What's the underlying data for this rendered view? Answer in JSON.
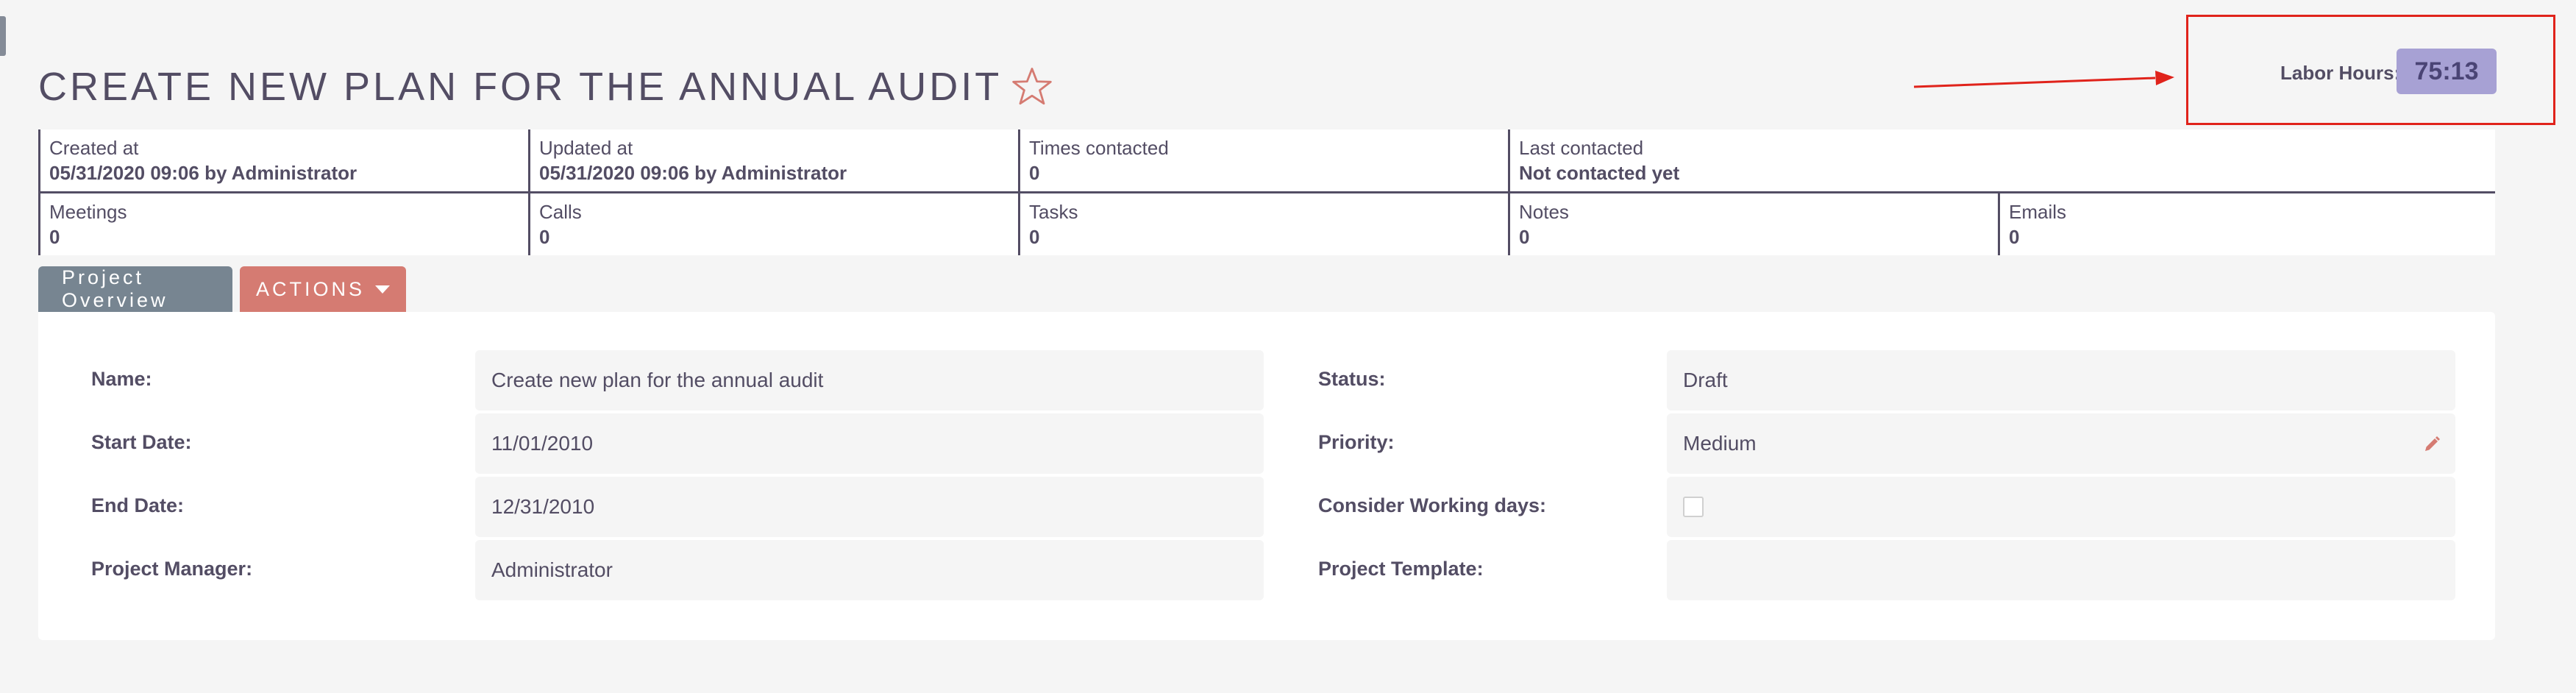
{
  "record": {
    "title": "CREATE NEW PLAN FOR THE ANNUAL AUDIT",
    "favorite_icon": "star-outline-icon"
  },
  "labor": {
    "label": "Labor Hours:",
    "value": "75:13"
  },
  "summary": {
    "row1": [
      {
        "label": "Created at",
        "value": "05/31/2020 09:06 by Administrator"
      },
      {
        "label": "Updated at",
        "value": "05/31/2020 09:06 by Administrator"
      },
      {
        "label": "Times contacted",
        "value": "0"
      },
      {
        "label": "Last contacted",
        "value": "Not contacted yet"
      }
    ],
    "row2": [
      {
        "label": "Meetings",
        "value": "0"
      },
      {
        "label": "Calls",
        "value": "0"
      },
      {
        "label": "Tasks",
        "value": "0"
      },
      {
        "label": "Notes",
        "value": "0"
      },
      {
        "label": "Emails",
        "value": "0"
      }
    ]
  },
  "tabs": {
    "overview": "Project Overview",
    "actions": "ACTIONS"
  },
  "fields": {
    "name": {
      "label": "Name:",
      "value": "Create new plan for the annual audit"
    },
    "start_date": {
      "label": "Start Date:",
      "value": "11/01/2010"
    },
    "end_date": {
      "label": "End Date:",
      "value": "12/31/2010"
    },
    "project_manager": {
      "label": "Project Manager:",
      "value": "Administrator"
    },
    "status": {
      "label": "Status:",
      "value": "Draft"
    },
    "priority": {
      "label": "Priority:",
      "value": "Medium"
    },
    "working_days": {
      "label": "Consider Working days:",
      "checked": false
    },
    "project_template": {
      "label": "Project Template:",
      "value": ""
    }
  },
  "colors": {
    "text": "#534d64",
    "tab_overview": "#778591",
    "tab_actions": "#d57b72",
    "labor_badge": "#a7a1d4",
    "annotation": "#e0231b"
  }
}
